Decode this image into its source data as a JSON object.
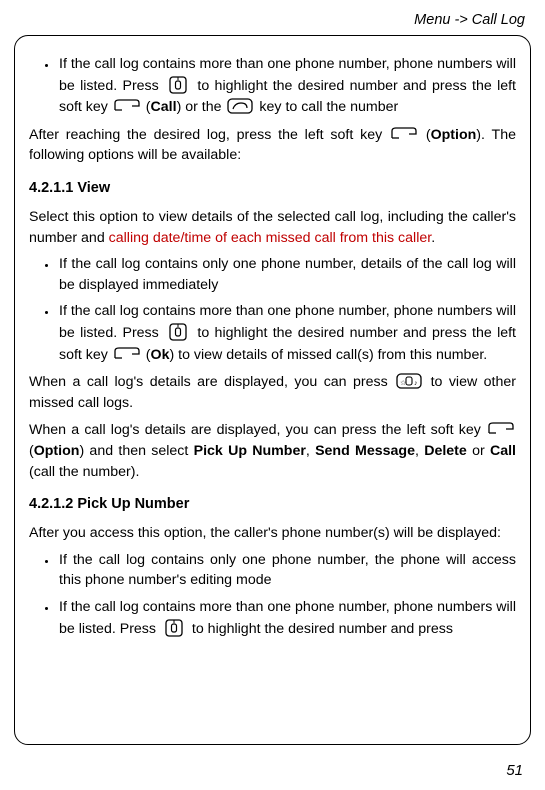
{
  "breadcrumb": "Menu -> Call Log",
  "page_number": "51",
  "intro_bullet": {
    "a": "If the call log contains more than one phone number, phone numbers will be listed. Press",
    "b": "to highlight the desired number and press the left soft key",
    "call": "Call",
    "c": ") or the",
    "d": "key to call the number"
  },
  "after_reach": {
    "a": "After reaching the desired log, press the left soft key",
    "option": "Option",
    "b": "). The following options will be available:"
  },
  "sec1": {
    "heading": "4.2.1.1 View",
    "p1a": "Select this option to view details of the selected call log, including the caller's number and ",
    "p1red": "calling date/time of each missed call from this caller",
    "p1b": ".",
    "b1": "If the call log contains only one phone number, details of the call log will be displayed immediately",
    "b2a": "If the call log contains more than one phone number, phone numbers will be listed. Press",
    "b2b": "to highlight the desired number and press the left soft key",
    "ok": "Ok",
    "b2c": ") to view details of missed call(s) from this number.",
    "p2a": "When a call log's details are displayed, you can press",
    "p2b": "to view other missed call logs.",
    "p3a": "When a call log's details are displayed, you can press the left soft key",
    "option": "Option",
    "p3b": ") and then select ",
    "pickup": "Pick Up Number",
    "sendmsg": "Send Message",
    "delete": "Delete",
    "p3c": " or ",
    "calln": "Call",
    "p3d": " (call the number)."
  },
  "sec2": {
    "heading": "4.2.1.2 Pick Up Number",
    "p1": "After you access this option, the caller's phone number(s) will be displayed:",
    "b1": "If the call log contains only one phone number, the phone will access this phone number's editing mode",
    "b2a": "If the call log contains more than one phone number, phone numbers will be listed. Press",
    "b2b": "to highlight the desired number and press"
  }
}
